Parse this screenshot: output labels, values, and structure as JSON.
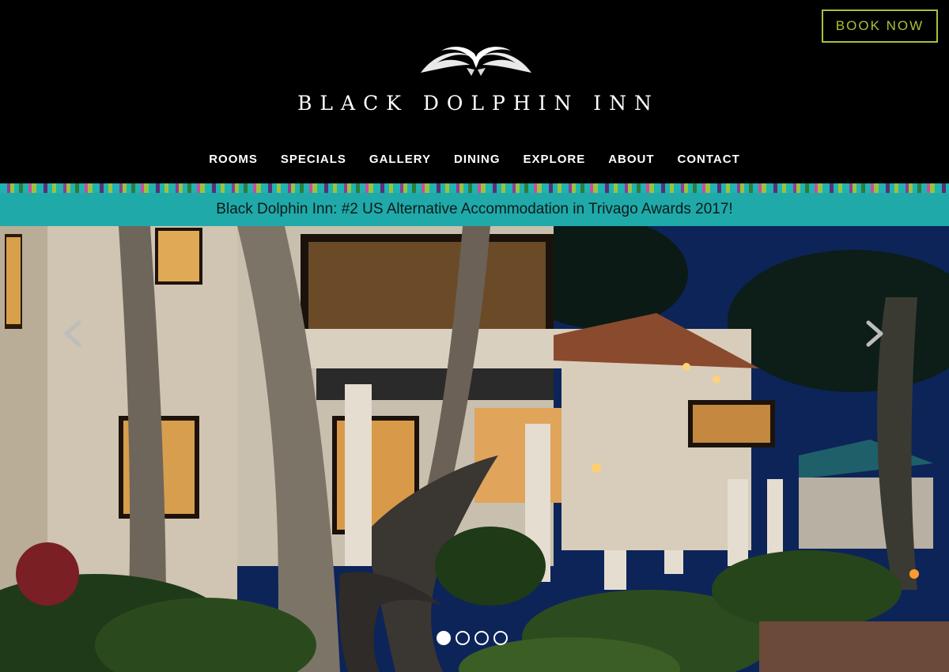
{
  "header": {
    "brand": "BLACK DOLPHIN INN",
    "logo_icon": "dolphins-logo-icon",
    "book_label": "BOOK NOW"
  },
  "nav": {
    "items": [
      "ROOMS",
      "SPECIALS",
      "GALLERY",
      "DINING",
      "EXPLORE",
      "ABOUT",
      "CONTACT"
    ]
  },
  "announcement": {
    "text": "Black Dolphin Inn: #2 US Alternative Accommodation in Trivago Awards 2017!"
  },
  "carousel": {
    "prev_icon": "chevron-left-icon",
    "next_icon": "chevron-right-icon",
    "slide_count": 4,
    "active_slide": 1
  },
  "colors": {
    "accent_green": "#a6c23a",
    "banner_teal": "#1fa9a9",
    "header_bg": "#000000"
  }
}
